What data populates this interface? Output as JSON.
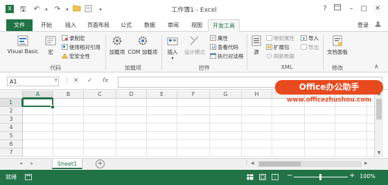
{
  "window": {
    "title": "工作簿1 - Excel",
    "help_label": "?",
    "signin_label": "登录"
  },
  "tabs": [
    "文件",
    "开始",
    "插入",
    "页面布局",
    "公式",
    "数据",
    "审阅",
    "视图",
    "开发工具"
  ],
  "ribbon": {
    "code": {
      "label": "代码",
      "visual_basic": "Visual Basic",
      "macros": "宏",
      "record_macro": "录制宏",
      "relative_refs": "使用相对引用",
      "macro_security": "宏安全性"
    },
    "addins": {
      "label": "加载项",
      "addins_button": "加载项",
      "com_addins": "COM 加载项"
    },
    "controls": {
      "label": "控件",
      "insert": "插入",
      "design_mode": "设计模式",
      "properties": "属性",
      "view_code": "查看代码",
      "run_dialog": "执行对话框"
    },
    "xml": {
      "label": "XML",
      "source": "源",
      "map_properties": "映射属性",
      "expansion_packs": "扩展包",
      "refresh_data": "刷新数据",
      "import": "导入",
      "export": "导出"
    },
    "modify": {
      "label": "修改",
      "document_panel": "文档面板"
    }
  },
  "formula_bar": {
    "name_box": "A1",
    "fx": "fx",
    "content": ""
  },
  "grid": {
    "columns": [
      "A",
      "B",
      "C",
      "D",
      "E",
      "F",
      "G",
      "H"
    ],
    "rows": [
      "1",
      "2",
      "3",
      "4",
      "5",
      "6",
      "7"
    ],
    "active_cell": "A1"
  },
  "sheets": {
    "tabs": [
      "Sheet1"
    ],
    "add_label": "+"
  },
  "status": {
    "ready": "就绪",
    "zoom": "100%"
  },
  "watermark": {
    "logo_text": "Office办公助手",
    "url": "www.officezhushou.com"
  },
  "colors": {
    "accent": "#217346",
    "watermark": "#e8491d"
  }
}
